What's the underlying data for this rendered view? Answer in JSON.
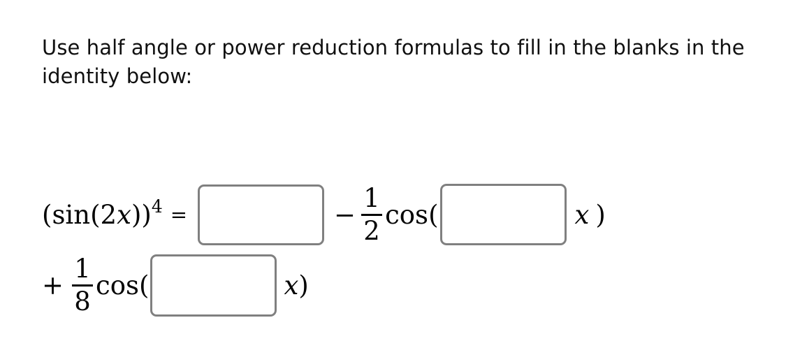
{
  "page": {
    "background_color": "#ffffff",
    "text_color": "#101010"
  },
  "prompt": {
    "text": "Use half angle or power reduction formulas to fill in the blanks in the identity below:"
  },
  "equation": {
    "description": "Power reduction identity for (sin(2x))^4 with three blank answer fields",
    "line1": {
      "lhs_open_paren": "(",
      "lhs_function": "sin",
      "lhs_inner_open": "(",
      "lhs_argument_coefficient": "2",
      "lhs_variable": "x",
      "lhs_inner_close": ")",
      "lhs_close_paren": ")",
      "exponent": "4",
      "equals": "=",
      "minus": "−",
      "fraction": {
        "numerator": "1",
        "denominator": "2"
      },
      "function": "cos",
      "open_paren": "(",
      "variable": "x",
      "close_paren": ")"
    },
    "line2": {
      "plus": "+",
      "fraction": {
        "numerator": "1",
        "denominator": "8"
      },
      "function": "cos",
      "open_paren": "(",
      "variable": "x",
      "close_paren": ")"
    }
  },
  "inputs": {
    "blank_1": {
      "value": "",
      "placeholder": "",
      "border_color": "#808080"
    },
    "blank_2": {
      "value": "",
      "placeholder": "",
      "border_color": "#808080"
    },
    "blank_3": {
      "value": "",
      "placeholder": "",
      "border_color": "#808080"
    }
  }
}
